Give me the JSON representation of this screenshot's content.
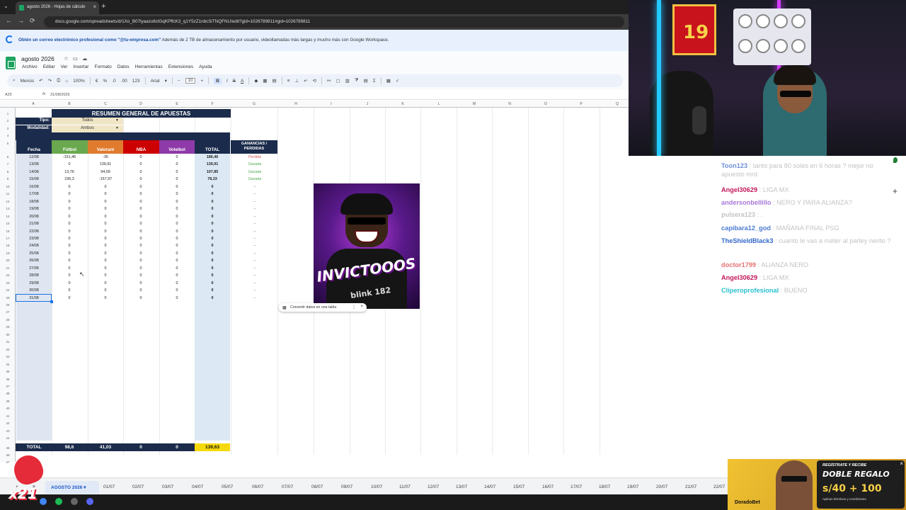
{
  "browser": {
    "tab_title": "agosto 2026 - Hojas de cálculo",
    "url": "docs.google.com/spreadsheets/d/1Xo_B07lyaazu6clGqKPffcK3_q1Y5zZ1nbcSiTNQFNU/edit?gid=1026789811#gid=1026789811",
    "banner_bold": "Obtén un correo electrónico profesional como \"@tu-empresa.com\"",
    "banner_rest": "Además de 2 TB de almacenamiento por usuario, videollamadas más largas y mucho más con Google Workspace."
  },
  "doc": {
    "title": "agosto 2026",
    "menu": [
      "Archivo",
      "Editar",
      "Ver",
      "Insertar",
      "Formato",
      "Datos",
      "Herramientas",
      "Extensiones",
      "Ayuda"
    ],
    "toolbar": {
      "menus": "Menús",
      "zoom": "100%",
      "font": "Arial",
      "font_size": "10",
      "num_fmt": "123"
    },
    "cell_ref": "A25",
    "formula_value": "31/08/2026"
  },
  "columns": [
    "A",
    "B",
    "C",
    "D",
    "E",
    "F",
    "G",
    "H",
    "I",
    "J",
    "K",
    "L",
    "M",
    "N",
    "O",
    "P",
    "Q"
  ],
  "sheet": {
    "title": "RESUMEN GENERAL DE APUESTAS",
    "tipo_label": "Tipo:",
    "tipo_value": "Todos",
    "modalidad_label": "Modalidad:",
    "modalidad_value": "Ambos",
    "headers": {
      "fecha": "Fecha",
      "futbol": "Fútbol",
      "valorant": "Valorant",
      "nba": "NBA",
      "voleibol": "Voleibol",
      "total": "TOTAL",
      "ganancias": "GANANCIAS / PERDIDAS"
    },
    "header_colors": {
      "fecha": "#1b2b4b",
      "futbol": "#6aa84f",
      "valorant": "#e07b2e",
      "nba": "#cc0000",
      "voleibol": "#8e3aa8",
      "total": "#1b2b4b"
    },
    "rows": [
      [
        "12/08",
        "-151,46",
        "-35",
        "0",
        "0",
        "186,46",
        "Perdida"
      ],
      [
        "13/08",
        "0",
        "139,91",
        "0",
        "0",
        "139,91",
        "Ganada"
      ],
      [
        "14/08",
        "13,76",
        "94,09",
        "0",
        "0",
        "107,85",
        "Ganada"
      ],
      [
        "15/08",
        "236,3",
        "-157,97",
        "0",
        "0",
        "78,33",
        "Ganada"
      ],
      [
        "16/08",
        "0",
        "0",
        "0",
        "0",
        "0",
        "--"
      ],
      [
        "17/08",
        "0",
        "0",
        "0",
        "0",
        "0",
        "--"
      ],
      [
        "18/08",
        "0",
        "0",
        "0",
        "0",
        "0",
        "--"
      ],
      [
        "19/08",
        "0",
        "0",
        "0",
        "0",
        "0",
        "--"
      ],
      [
        "20/08",
        "0",
        "0",
        "0",
        "0",
        "0",
        "--"
      ],
      [
        "21/08",
        "0",
        "0",
        "0",
        "0",
        "0",
        "--"
      ],
      [
        "22/08",
        "0",
        "0",
        "0",
        "0",
        "0",
        "--"
      ],
      [
        "23/08",
        "0",
        "0",
        "0",
        "0",
        "0",
        "--"
      ],
      [
        "24/08",
        "0",
        "0",
        "0",
        "0",
        "0",
        "--"
      ],
      [
        "25/08",
        "0",
        "0",
        "0",
        "0",
        "0",
        "--"
      ],
      [
        "26/08",
        "0",
        "0",
        "0",
        "0",
        "0",
        "--"
      ],
      [
        "27/08",
        "0",
        "0",
        "0",
        "0",
        "0",
        "--"
      ],
      [
        "28/08",
        "0",
        "0",
        "0",
        "0",
        "0",
        "--"
      ],
      [
        "29/08",
        "0",
        "0",
        "0",
        "0",
        "0",
        "--"
      ],
      [
        "30/08",
        "0",
        "0",
        "0",
        "0",
        "0",
        "--"
      ],
      [
        "31/08",
        "0",
        "0",
        "0",
        "0",
        "0",
        "--"
      ]
    ],
    "totals": {
      "label": "TOTAL",
      "futbol": "98,6",
      "valorant": "41,03",
      "nba": "0",
      "voleibol": "0",
      "grand": "139,63"
    }
  },
  "float_image": {
    "headline": "INVICTOOOS",
    "subline": "blink 182"
  },
  "chip": {
    "label": "Convertir datos en una tabla"
  },
  "sheet_tabs": [
    "AGOSTO 2026",
    "01/07",
    "02/07",
    "03/07",
    "04/07",
    "05/07",
    "06/07",
    "07/07",
    "08/07",
    "09/07",
    "10/07",
    "11/07",
    "12/07",
    "13/07",
    "14/07",
    "15/07",
    "16/07",
    "17/07",
    "18/07",
    "19/07",
    "20/07",
    "21/07",
    "22/07"
  ],
  "stream": {
    "jersey_number": "19"
  },
  "chat": [
    {
      "user": "Toon123",
      "text": ": tanto para 80 soles en 6 horas ? mejor no apuesto mrd",
      "color": "#6e8fd8"
    },
    {
      "user": "Angel30629",
      "text": ": LIGA MX",
      "color": "#c2185b"
    },
    {
      "user": "andersonbellillo",
      "text": ": NERO Y PARA ALIANZA?",
      "color": "#a678d8"
    },
    {
      "user": "pulsera123",
      "text": ": .",
      "color": "#c3c3c3"
    },
    {
      "user": "capibara12_god",
      "text": ": MAÑANA FINAL PSG",
      "color": "#4a7bd0"
    },
    {
      "user": "TheShieldBlack3",
      "text": ": cuanto le vas a meter al parley nerito ?",
      "color": "#3366cc"
    },
    {
      "user": "doctor1799",
      "text": ": ALIANZA NERO",
      "color": "#e57373"
    },
    {
      "user": "Angel30629",
      "text": ": LIGA MX",
      "color": "#c2185b"
    },
    {
      "user": "Cliperoprofesional",
      "text": ": BUENO",
      "color": "#2bbfcf"
    }
  ],
  "ad": {
    "line1": "REGÍSTRATE Y RECIBE",
    "line2": "DOBLE REGALO",
    "line3": "s/40 + 100",
    "line4": "Aplican términos y condiciones",
    "brand": "DoradoBet"
  },
  "brand_logo": "x21"
}
